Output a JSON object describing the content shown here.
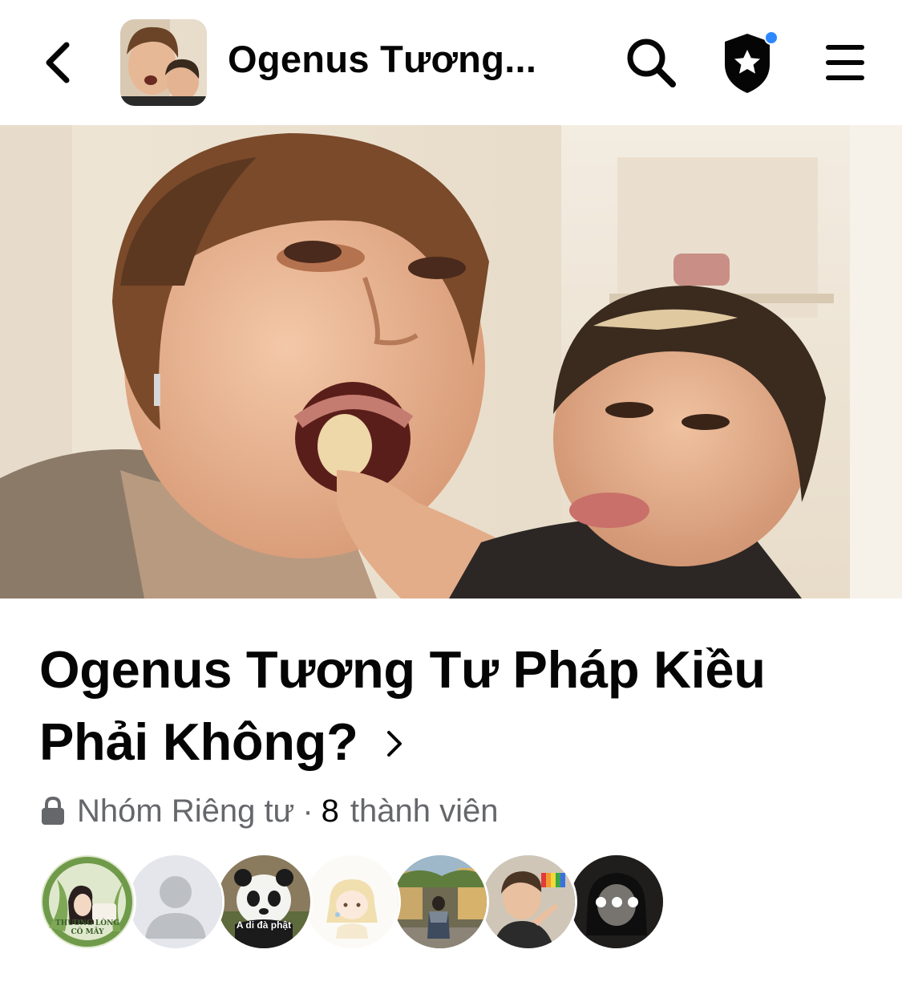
{
  "header": {
    "title": "Ogenus Tương...",
    "back_icon": "chevron-left-icon",
    "search_icon": "search-icon",
    "admin_icon": "shield-star-icon",
    "menu_icon": "hamburger-menu-icon",
    "notification_dot_color": "#2d88ff"
  },
  "group": {
    "name": "Ogenus Tương Tư Pháp Kiều Phải Không?",
    "privacy": "Nhóm Riêng tư",
    "separator": "·",
    "member_count": "8",
    "member_label": "thành viên"
  },
  "members": {
    "avatars": [
      {
        "kind": "photo",
        "caption": "THƯƠNG LÒNG CÔ MÂY"
      },
      {
        "kind": "default-avatar",
        "caption": ""
      },
      {
        "kind": "photo",
        "caption": "A di đà phật"
      },
      {
        "kind": "drawing",
        "caption": ""
      },
      {
        "kind": "photo",
        "caption": ""
      },
      {
        "kind": "photo",
        "caption": ""
      },
      {
        "kind": "more",
        "caption": ""
      }
    ]
  },
  "colors": {
    "text_primary": "#050505",
    "text_secondary": "#65676b",
    "accent": "#2d88ff"
  }
}
